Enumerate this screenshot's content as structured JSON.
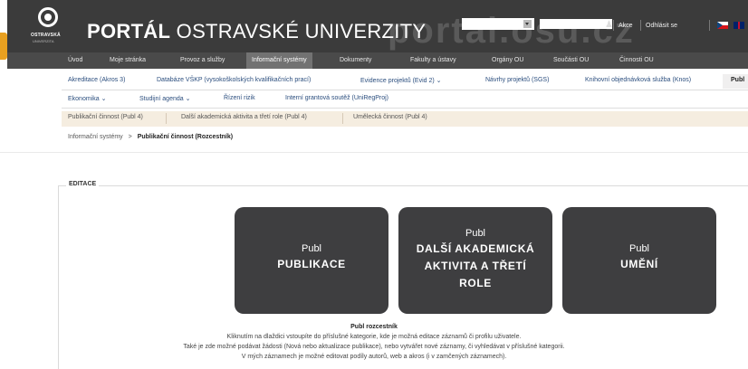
{
  "header": {
    "logo_text": "OSTRAVSKÁ",
    "logo_sub": "UNIVERZITA",
    "title_bold": "PORTÁL",
    "title_rest": " OSTRAVSKÉ UNIVERZITY",
    "watermark": "portal.osu.cz",
    "links": {
      "akce": "Akce",
      "logout": "Odhlásit se"
    }
  },
  "main_nav": [
    "Úvod",
    "Moje stránka",
    "Provoz a služby",
    "Informační systémy",
    "Dokumenty",
    "Fakulty a ústavy",
    "Orgány OU",
    "Součásti OU",
    "Činnosti OU"
  ],
  "sub_nav_row1": [
    "Akreditace (Akros 3)",
    "Databáze VŠKP (vysokoškolských kvalifikačních prací)",
    "Evidence projektů (Evid 2) ⌄",
    "Návrhy projektů (SGS)",
    "Knihovní objednávková služba (Knos)",
    "Publ"
  ],
  "sub_nav_row2": [
    "Ekonomika ⌄",
    "Studijní agenda ⌄",
    "Řízení rizik",
    "Interní grantová soutěž (UniRegProj)"
  ],
  "tert_nav": [
    "Publikační činnost (Publ 4)",
    "Další akademická aktivita a třetí role (Publ 4)",
    "Umělecká činnost (Publ 4)"
  ],
  "breadcrumb": {
    "parent": "Informační systémy",
    "separator": ">",
    "current": "Publikační činnost (Rozcestník)"
  },
  "section_label": "EDITACE",
  "tiles": [
    {
      "sub": "Publ",
      "title": "PUBLIKACE"
    },
    {
      "sub": "Publ",
      "title_lines": [
        "DALŠÍ AKADEMICKÁ",
        "AKTIVITA A TŘETÍ",
        "ROLE"
      ]
    },
    {
      "sub": "Publ",
      "title": "UMĚNÍ"
    }
  ],
  "footer": {
    "title": "Publ rozcestník",
    "lines": [
      "Kliknutím na dlaždici vstoupíte do příslušné kategorie, kde je možná editace záznamů či profilu uživatele.",
      "Také je zde možné podávat žádosti (Nová nebo aktualizace publikace), nebo vytvářet nové záznamy, či vyhledávat v příslušné kategorii.",
      "V mých záznamech je možné editovat podíly autorů, web a akros (i v zamčených záznamech)."
    ]
  },
  "colors": {
    "header_bg": "#3b3b3b",
    "nav_bg": "#4a4a4a",
    "nav_active": "#727272",
    "tile_bg": "#3e3e40",
    "tert_bg": "#f5ede0",
    "accent_tab": "#e8a020",
    "link": "#2b4e7e"
  }
}
